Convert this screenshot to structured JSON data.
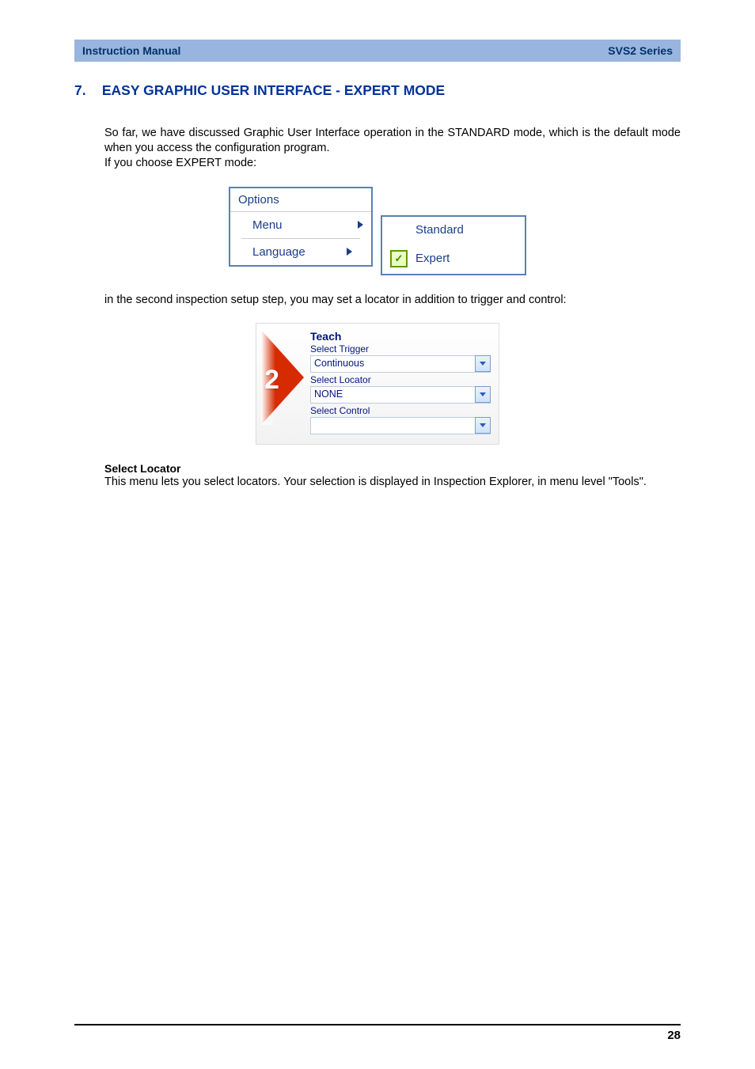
{
  "header": {
    "left": "Instruction Manual",
    "right": "SVS2 Series"
  },
  "section": {
    "number": "7.",
    "title": "EASY GRAPHIC USER INTERFACE - EXPERT MODE"
  },
  "intro": {
    "line1": "So far, we have discussed Graphic User Interface operation in the STANDARD mode, which is the default mode when you access the configuration program.",
    "line2": "If you choose EXPERT mode:"
  },
  "options_menu": {
    "title": "Options",
    "items": [
      "Menu",
      "Language"
    ],
    "submenu": [
      "Standard",
      "Expert"
    ],
    "selected": "Expert"
  },
  "mid_text": "in the second inspection setup step, you may set a locator in addition to trigger and control:",
  "teach_panel": {
    "step_number": "2",
    "title": "Teach",
    "sel_trigger_label": "Select Trigger",
    "sel_trigger_value": "Continuous",
    "sel_locator_label": "Select Locator",
    "sel_locator_value": "NONE",
    "sel_control_label": "Select Control",
    "sel_control_value": ""
  },
  "select_locator_head": "Select Locator",
  "select_locator_body": "This menu lets you select locators. Your selection is displayed in Inspection Explorer, in menu level \"Tools\".",
  "page_number": "28"
}
